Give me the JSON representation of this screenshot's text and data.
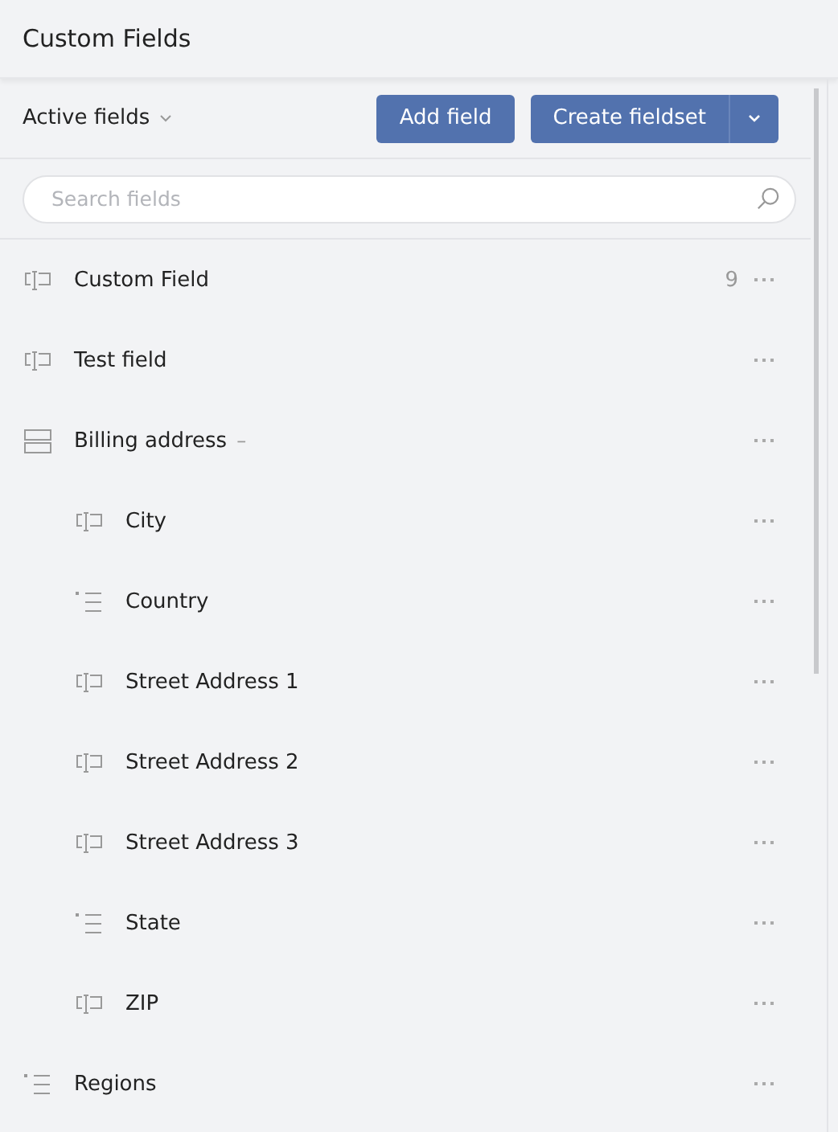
{
  "header": {
    "title": "Custom Fields"
  },
  "toolbar": {
    "filter": "Active fields",
    "add_button": "Add field",
    "create_button": "Create fieldset"
  },
  "search": {
    "placeholder": "Search fields"
  },
  "fields": [
    {
      "kind": "text",
      "name": "Custom Field",
      "count": "9"
    },
    {
      "kind": "text",
      "name": "Test field"
    },
    {
      "kind": "fieldset",
      "name": "Billing address",
      "toggle": "–",
      "expanded": true,
      "children": [
        {
          "kind": "text",
          "name": "City"
        },
        {
          "kind": "list",
          "name": "Country"
        },
        {
          "kind": "text",
          "name": "Street Address 1"
        },
        {
          "kind": "text",
          "name": "Street Address 2"
        },
        {
          "kind": "text",
          "name": "Street Address 3"
        },
        {
          "kind": "list",
          "name": "State"
        },
        {
          "kind": "text",
          "name": "ZIP"
        }
      ]
    },
    {
      "kind": "list",
      "name": "Regions"
    }
  ]
}
